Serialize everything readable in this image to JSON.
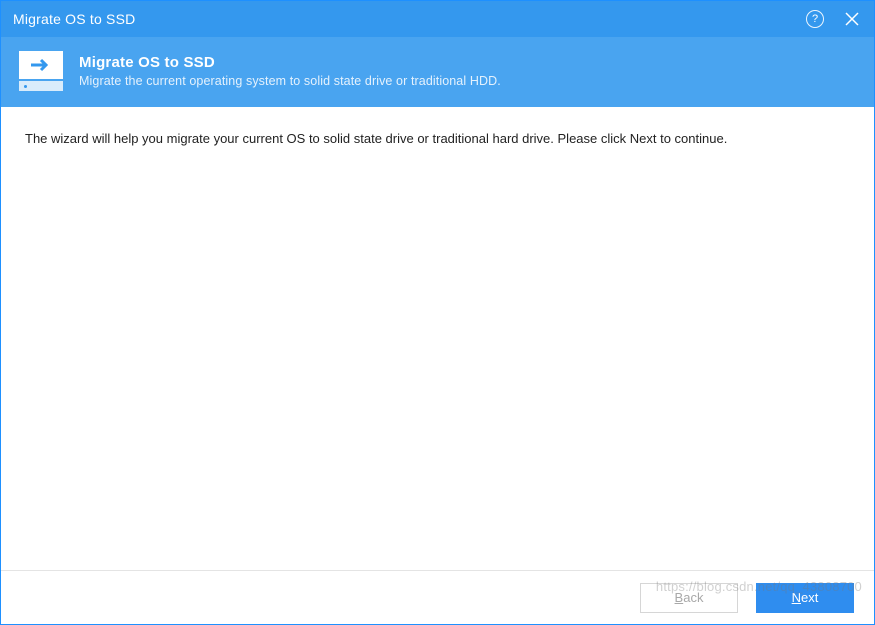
{
  "titlebar": {
    "title": "Migrate OS to SSD"
  },
  "banner": {
    "title": "Migrate OS to SSD",
    "subtitle": "Migrate the current operating system to solid state drive or traditional HDD."
  },
  "content": {
    "message": "The wizard will help you migrate your current OS to solid state drive or traditional hard drive. Please click Next to continue."
  },
  "footer": {
    "back_label_pre": "",
    "back_label_u": "B",
    "back_label_post": "ack",
    "next_label_pre": "",
    "next_label_u": "N",
    "next_label_post": "ext"
  },
  "watermark": "https://blog.csdn.net/qq_43808700"
}
